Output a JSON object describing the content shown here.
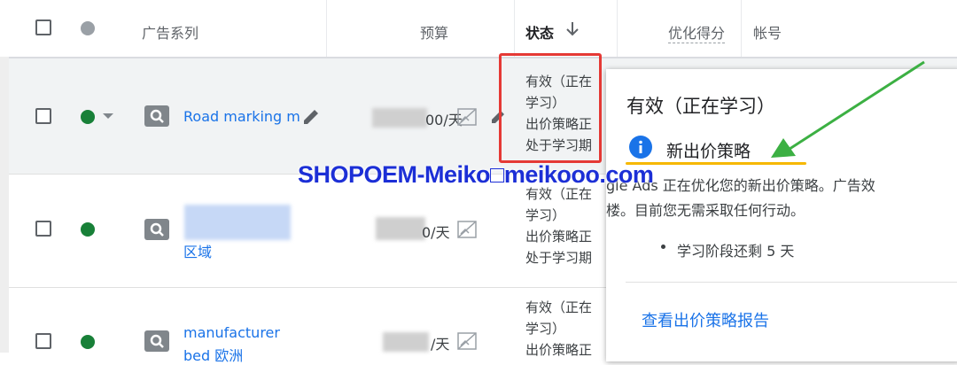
{
  "header": {
    "campaign_label": "广告系列",
    "budget_label": "预算",
    "status_label": "状态",
    "optimization_label": "优化得分",
    "account_label": "帐号"
  },
  "rows": [
    {
      "name": "Road marking m",
      "name_line2": "",
      "budget": "00/天",
      "status_line1": "有效（正在",
      "status_line2": "学习）",
      "status_line3": "出价策略正",
      "status_line4": "处于学习期"
    },
    {
      "name": "",
      "name_line2": "区域",
      "budget": "0/天",
      "status_line1": "有效（正在",
      "status_line2": "学习）",
      "status_line3": "出价策略正",
      "status_line4": "处于学习期"
    },
    {
      "name": "manufacturer",
      "name_line2": "bed 欧洲",
      "budget": "/天",
      "status_line1": "有效（正在",
      "status_line2": "学习）",
      "status_line3": "出价策略正",
      "status_line4": ""
    }
  ],
  "popup": {
    "title": "有效（正在学习）",
    "info_heading": "新出价策略",
    "body_line1": "gle Ads 正在优化您的新出价策略。广告效",
    "body_line2": "楼。目前您无需采取任何行动。",
    "bullet": "学习阶段还剩 5 天",
    "report_link": "查看出价策略报告"
  },
  "watermark": "SHOPOEM-Meiko□meikooo.com",
  "colors": {
    "active_green": "#188038",
    "link_blue": "#1a73e8",
    "highlight_red": "#e53935",
    "arrow_green": "#3cb043",
    "underline_yellow": "#f6b800",
    "watermark_blue": "#1c2fd6"
  }
}
